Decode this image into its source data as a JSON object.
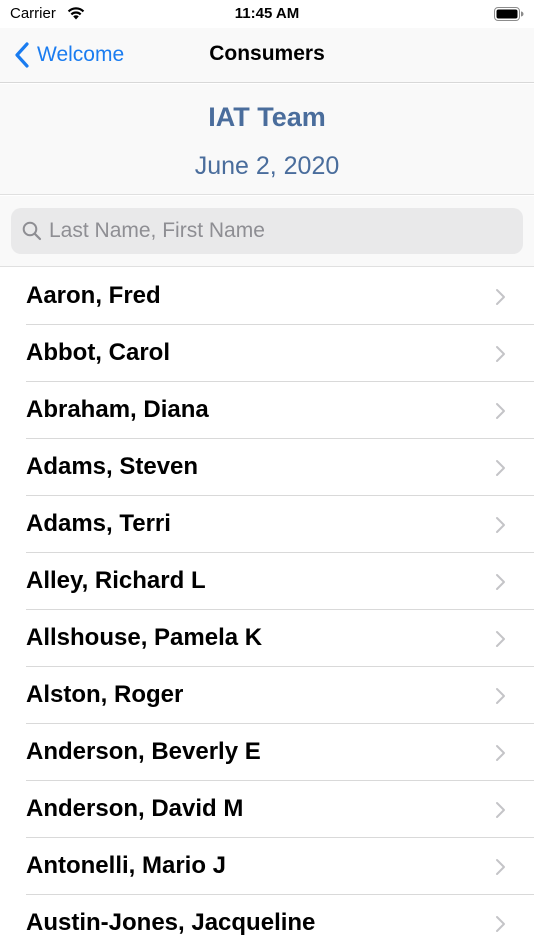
{
  "status_bar": {
    "carrier": "Carrier",
    "time": "11:45 AM"
  },
  "nav": {
    "back_label": "Welcome",
    "title": "Consumers"
  },
  "header": {
    "team": "IAT Team",
    "date": "June 2, 2020"
  },
  "search": {
    "placeholder": "Last Name, First Name",
    "value": ""
  },
  "consumers": [
    "Aaron, Fred",
    "Abbot, Carol",
    "Abraham, Diana",
    "Adams, Steven",
    "Adams, Terri",
    "Alley, Richard L",
    "Allshouse, Pamela K",
    "Alston, Roger",
    "Anderson, Beverly E",
    "Anderson, David M",
    "Antonelli, Mario J",
    "Austin-Jones, Jacqueline"
  ],
  "colors": {
    "accent": "#1a7cf0",
    "header_text": "#4a6d9c",
    "chevron": "#c4c4c7"
  },
  "icons": {
    "back": "chevron-left-icon",
    "row": "chevron-right-icon",
    "search": "search-icon",
    "wifi": "wifi-icon",
    "battery": "battery-icon"
  }
}
